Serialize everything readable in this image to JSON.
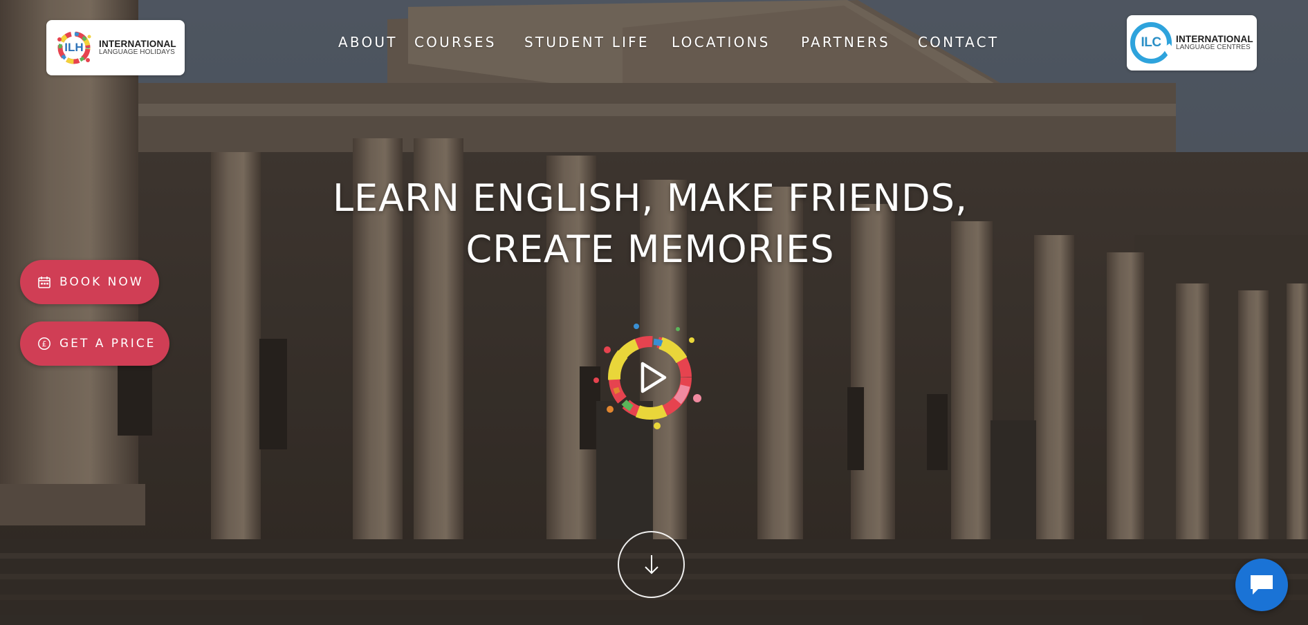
{
  "header": {
    "logo_left": {
      "mark": "ILH",
      "name": "INTERNATIONAL",
      "subname": "LANGUAGE HOLIDAYS"
    },
    "logo_right": {
      "mark": "ILC",
      "name": "INTERNATIONAL",
      "subname": "LANGUAGE CENTRES"
    },
    "nav": [
      {
        "label": "ABOUT"
      },
      {
        "label": "COURSES"
      },
      {
        "label": "STUDENT LIFE"
      },
      {
        "label": "LOCATIONS"
      },
      {
        "label": "PARTNERS"
      },
      {
        "label": "CONTACT"
      }
    ]
  },
  "hero": {
    "headline_line1": "LEARN ENGLISH, MAKE FRIENDS,",
    "headline_line2": "CREATE MEMORIES",
    "play_icon": "play-icon",
    "scroll_icon": "arrow-down-icon"
  },
  "side_actions": {
    "book_now": {
      "label": "BOOK NOW",
      "icon": "calendar-icon"
    },
    "get_price": {
      "label": "GET A PRICE",
      "icon": "pound-coin-icon"
    }
  },
  "chat": {
    "icon": "chat-bubble-icon"
  },
  "colors": {
    "accent_red": "#d03e55",
    "chat_blue": "#1a73d6",
    "ilc_blue": "#2ea3dc",
    "text_white": "#ffffff"
  }
}
